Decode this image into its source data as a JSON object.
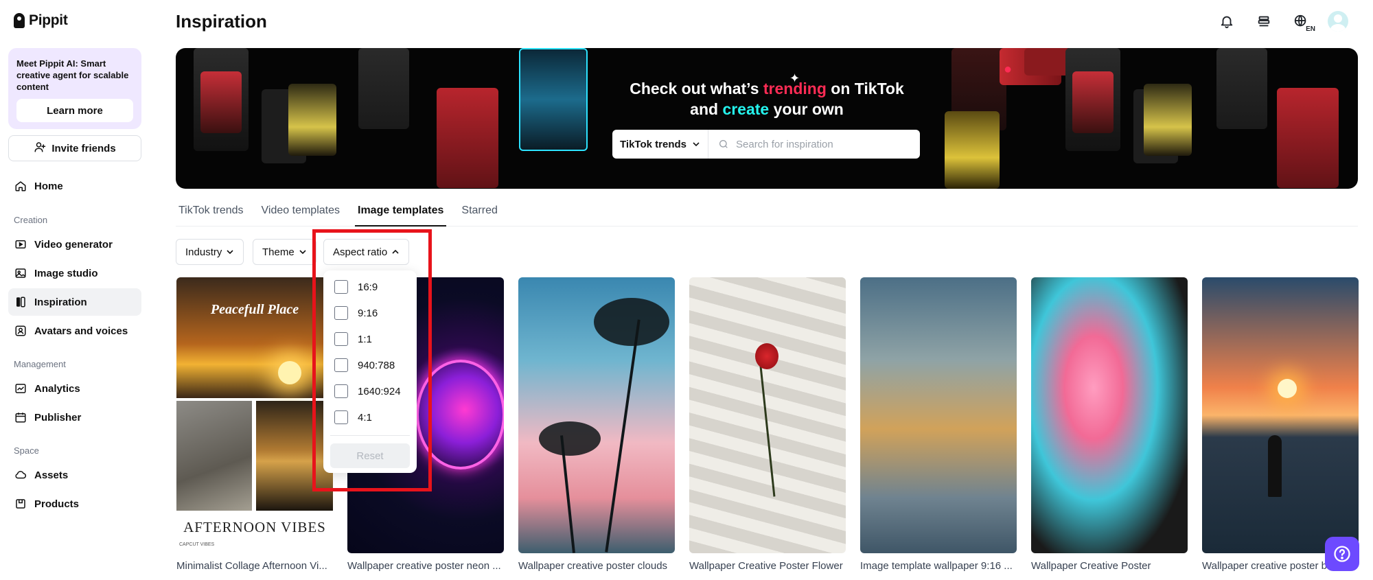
{
  "app": {
    "name": "Pippit"
  },
  "sidebar": {
    "promo": {
      "text": "Meet Pippit AI: Smart creative agent for scalable content",
      "button": "Learn more"
    },
    "invite_label": "Invite friends",
    "home_label": "Home",
    "sections": {
      "creation": "Creation",
      "management": "Management",
      "space": "Space"
    },
    "items": {
      "video_generator": "Video generator",
      "image_studio": "Image studio",
      "inspiration": "Inspiration",
      "avatars_voices": "Avatars and voices",
      "analytics": "Analytics",
      "publisher": "Publisher",
      "assets": "Assets",
      "products": "Products"
    }
  },
  "header": {
    "title": "Inspiration",
    "lang_badge": "EN"
  },
  "banner": {
    "line1_a": "Check out what’s ",
    "line1_b": "trending",
    "line1_c": " on TikTok",
    "line2_a": "and ",
    "line2_b": "create",
    "line2_c": " your own",
    "select_value": "TikTok trends",
    "search_placeholder": "Search for inspiration"
  },
  "tabs": {
    "tiktok_trends": "TikTok trends",
    "video_templates": "Video templates",
    "image_templates": "Image templates",
    "starred": "Starred"
  },
  "filters": {
    "industry": "Industry",
    "theme": "Theme",
    "aspect_ratio": "Aspect ratio"
  },
  "aspect_dropdown": {
    "options": [
      "16:9",
      "9:16",
      "1:1",
      "940:788",
      "1640:924",
      "4:1"
    ],
    "reset": "Reset"
  },
  "cards": {
    "c1": {
      "title": "Minimalist Collage Afternoon Vi...",
      "img_heading": "Peacefull Place",
      "img_caption": "AFTERNOON VIBES",
      "img_foot": "CAPCUT VIBES"
    },
    "c2": {
      "title": "Wallpaper creative poster neon ..."
    },
    "c3": {
      "title": "Wallpaper creative poster clouds"
    },
    "c4": {
      "title": "Wallpaper Creative Poster Flower"
    },
    "c5": {
      "title": "Image template wallpaper 9:16 ..."
    },
    "c6": {
      "title": "Wallpaper Creative Poster"
    },
    "c7": {
      "title": "Wallpaper creative poster beach"
    }
  },
  "colors": {
    "accent_purple": "#6d4aff",
    "tiktok_pink": "#fe2c55",
    "tiktok_cyan": "#25f4ee",
    "highlight_red": "#e8131b"
  }
}
